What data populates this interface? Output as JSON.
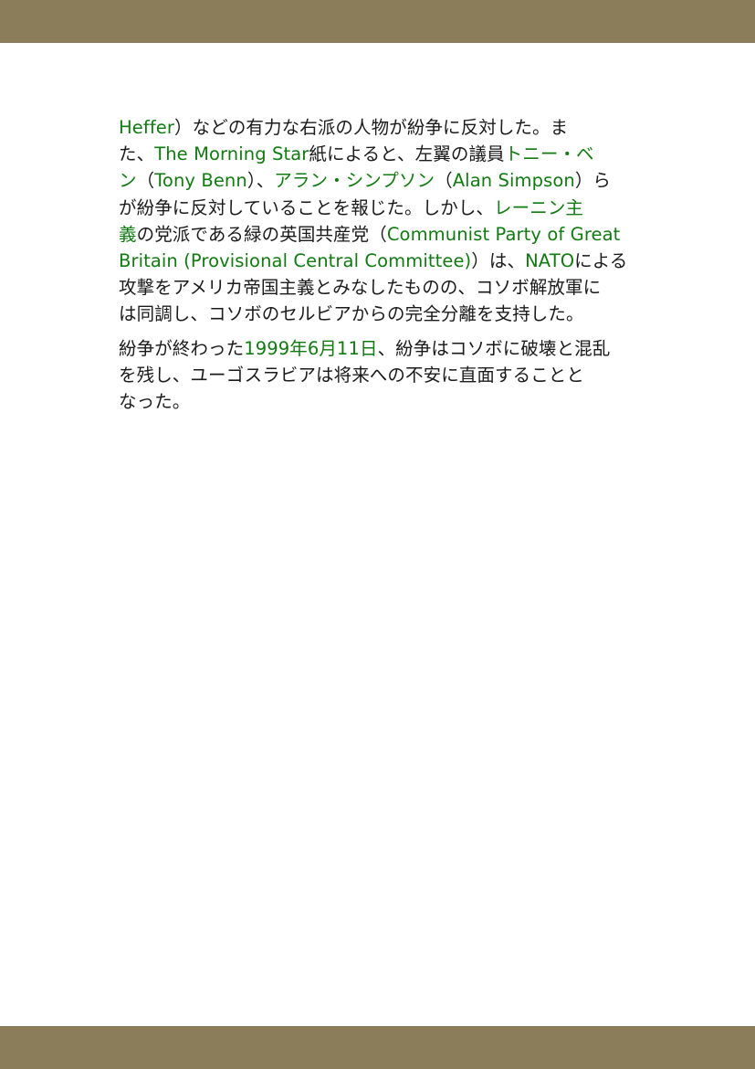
{
  "colors": {
    "band": "#8b7d5a",
    "text": "#1a1a1a",
    "link": "#117a11"
  },
  "paragraph1": {
    "lines": [
      [
        {
          "text": "Heffer",
          "link": true
        },
        {
          "text": "）などの有力な右派の人物が紛争に反対した。ま",
          "link": false
        }
      ],
      [
        {
          "text": "た、",
          "link": false
        },
        {
          "text": "The Morning Star",
          "link": true
        },
        {
          "text": "紙によると、左翼の議員",
          "link": false
        },
        {
          "text": "トニー・ベ",
          "link": true
        }
      ],
      [
        {
          "text": "ン",
          "link": true
        },
        {
          "text": "（",
          "link": false
        },
        {
          "text": "Tony Benn",
          "link": true
        },
        {
          "text": "）、",
          "link": false
        },
        {
          "text": "アラン・シンプソン",
          "link": true
        },
        {
          "text": "（",
          "link": false
        },
        {
          "text": "Alan Simpson",
          "link": true
        },
        {
          "text": "）ら",
          "link": false
        }
      ],
      [
        {
          "text": "が紛争に反対していることを報じた。しかし、",
          "link": false
        },
        {
          "text": "レーニン主",
          "link": true
        }
      ],
      [
        {
          "text": "義",
          "link": true
        },
        {
          "text": "の党派である緑の英国共産党（",
          "link": false
        },
        {
          "text": "Communist Party of Great",
          "link": true
        }
      ],
      [
        {
          "text": "Britain (Provisional Central Committee)",
          "link": true
        },
        {
          "text": "）は、",
          "link": false
        },
        {
          "text": "NATO",
          "link": true
        },
        {
          "text": "による",
          "link": false
        }
      ],
      [
        {
          "text": "攻撃をアメリカ帝国主義とみなしたものの、コソボ解放軍に",
          "link": false
        }
      ],
      [
        {
          "text": "は同調し、コソボのセルビアからの完全分離を支持した。",
          "link": false
        }
      ]
    ]
  },
  "paragraph2": {
    "lines": [
      [
        {
          "text": "紛争が終わった",
          "link": false
        },
        {
          "text": "1999年6月11日",
          "link": true
        },
        {
          "text": "、紛争はコソボに破壊と混乱",
          "link": false
        }
      ],
      [
        {
          "text": "を残し、ユーゴスラビアは将来への不安に直面することと",
          "link": false
        }
      ],
      [
        {
          "text": "なった。",
          "link": false
        }
      ]
    ]
  }
}
